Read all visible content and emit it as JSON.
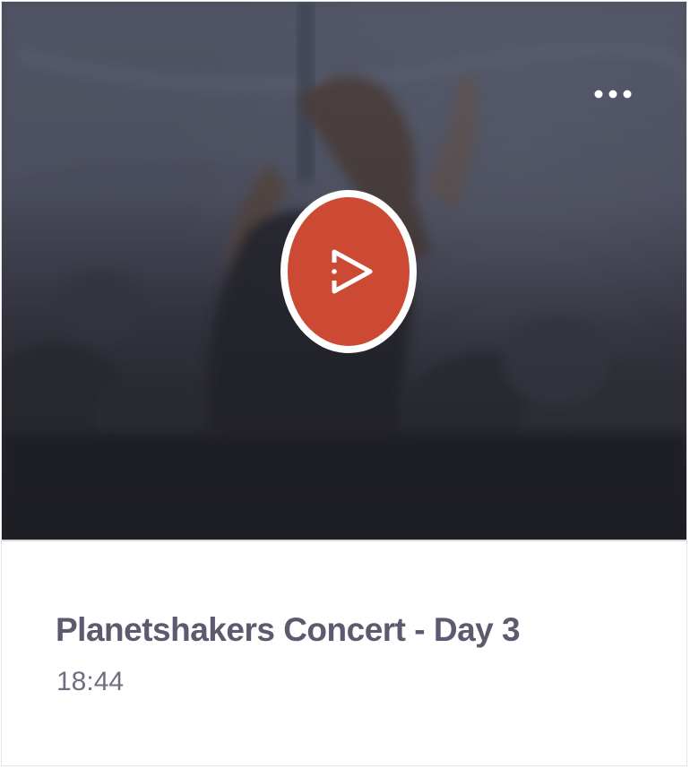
{
  "card": {
    "title": "Planetshakers Concert - Day 3",
    "duration": "18:44",
    "icons": {
      "play": "play-icon",
      "more": "more-options-icon"
    }
  },
  "colors": {
    "play_button_fill": "#cc4a33",
    "play_button_ring": "#ffffff",
    "title_text": "#5b5a6e",
    "duration_text": "#6f6e80",
    "thumbnail_overlay": "#2e2e38"
  }
}
